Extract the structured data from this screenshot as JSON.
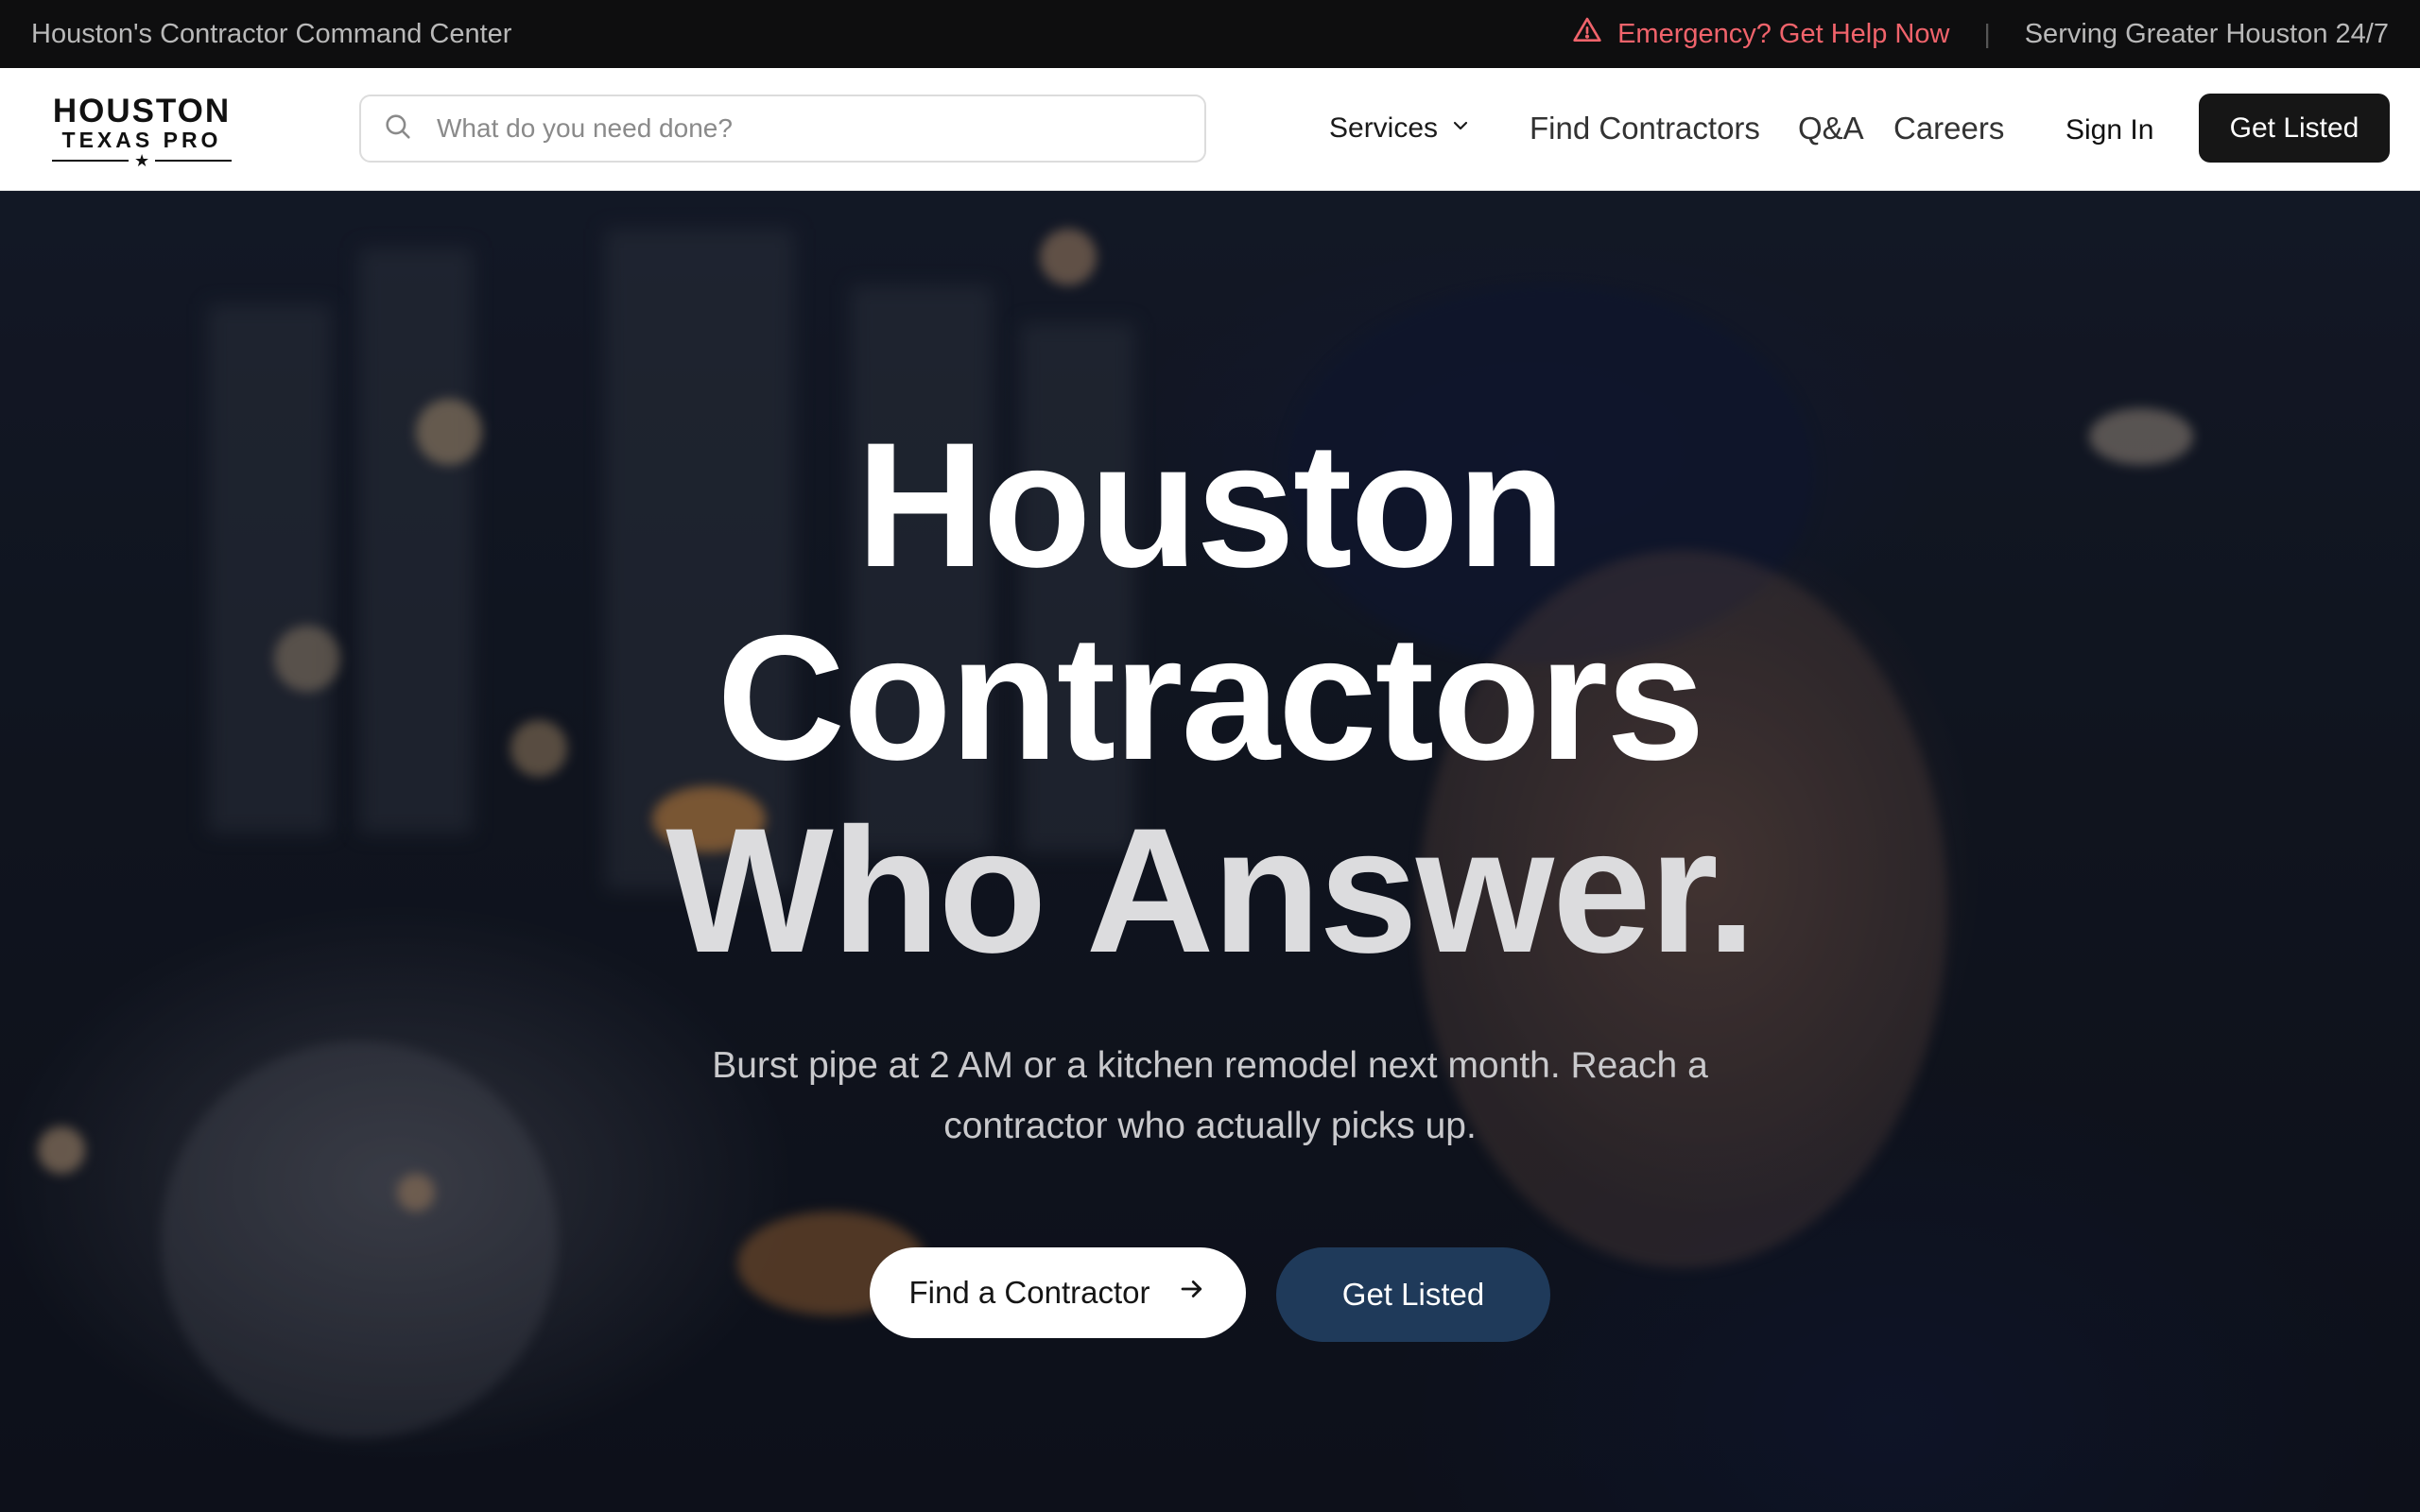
{
  "topbar": {
    "tagline": "Houston's Contractor Command Center",
    "emergency": "Emergency? Get Help Now",
    "separator": "|",
    "serving": "Serving Greater Houston 24/7"
  },
  "logo": {
    "line1": "HOUSTON",
    "line2": "TEXAS PRO",
    "star": "★"
  },
  "search": {
    "placeholder": "What do you need done?",
    "value": ""
  },
  "nav": {
    "services": "Services",
    "find_contractors": "Find Contractors",
    "qa": "Q&A",
    "careers": "Careers",
    "sign_in": "Sign In",
    "get_listed": "Get Listed"
  },
  "hero": {
    "title_line1": "Houston",
    "title_line2": "Contractors",
    "title_line3": "Who Answer.",
    "subtitle": "Burst pipe at 2 AM or a kitchen remodel next month. Reach a contractor who actually picks up.",
    "cta_primary": "Find a Contractor",
    "cta_secondary": "Get Listed"
  },
  "icons": {
    "emergency": "warning-triangle-icon",
    "search": "search-icon",
    "services_dropdown": "chevron-down-icon",
    "cta_arrow": "arrow-right-icon"
  },
  "colors": {
    "topbar_bg": "#0e0e0f",
    "emergency": "#f0636b",
    "header_bg": "#ffffff",
    "dark_button": "#161616",
    "secondary_cta": "#1f3a5a",
    "hero_title": "#ffffff"
  }
}
